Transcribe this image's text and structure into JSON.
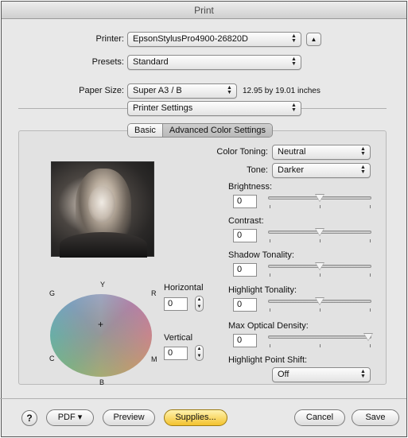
{
  "window": {
    "title": "Print"
  },
  "printer": {
    "label": "Printer:",
    "value": "EpsonStylusPro4900-26820D"
  },
  "presets": {
    "label": "Presets:",
    "value": "Standard"
  },
  "paper": {
    "label": "Paper Size:",
    "value": "Super A3 / B",
    "dimensions": "12.95 by 19.01 inches"
  },
  "section": {
    "value": "Printer Settings"
  },
  "tabs": [
    {
      "label": "Basic",
      "active": false
    },
    {
      "label": "Advanced Color Settings",
      "active": true
    }
  ],
  "color_toning": {
    "label": "Color Toning:",
    "value": "Neutral"
  },
  "tone": {
    "label": "Tone:",
    "value": "Darker"
  },
  "sliders": [
    {
      "label": "Brightness:",
      "value": "0",
      "level": 0.5
    },
    {
      "label": "Contrast:",
      "value": "0",
      "level": 0.5
    },
    {
      "label": "Shadow Tonality:",
      "value": "0",
      "level": 0.5
    },
    {
      "label": "Highlight Tonality:",
      "value": "0",
      "level": 0.5
    },
    {
      "label": "Max Optical Density:",
      "value": "0",
      "level": 1.0
    }
  ],
  "highlight_point_shift": {
    "label": "Highlight Point Shift:",
    "value": "Off"
  },
  "color_wheel": {
    "labels": {
      "top": "Y",
      "left_top": "G",
      "right_top": "R",
      "left_bottom": "C",
      "right_bottom": "M",
      "bottom": "B"
    },
    "horizontal": {
      "label": "Horizontal",
      "value": "0"
    },
    "vertical": {
      "label": "Vertical",
      "value": "0"
    }
  },
  "footer": {
    "help": "?",
    "pdf": "PDF ▾",
    "preview": "Preview",
    "supplies": "Supplies...",
    "cancel": "Cancel",
    "save": "Save"
  },
  "icons": {
    "updown": "up-down-arrows-icon",
    "disclosure": "disclosure-triangle-icon",
    "crosshair": "crosshair-icon"
  }
}
